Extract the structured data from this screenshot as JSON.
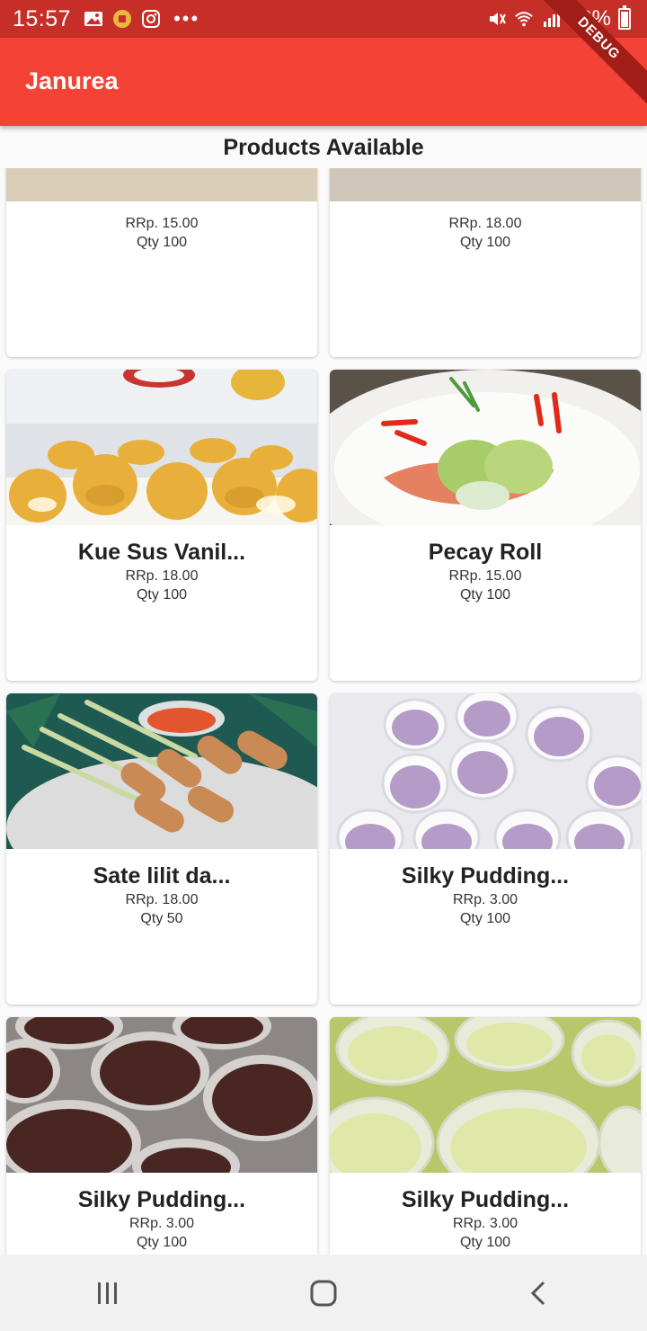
{
  "status_bar": {
    "time": "15:57",
    "battery_text": "99%",
    "icons": [
      "gallery-icon",
      "notification-icon",
      "instagram-icon",
      "more-dots-icon",
      "mute-icon",
      "wifi-icon",
      "signal-icon",
      "battery-icon"
    ]
  },
  "app_bar": {
    "title": "Janurea"
  },
  "debug_banner": "DEBUG",
  "section_title": "Products Available",
  "products": [
    {
      "name": "",
      "price": "RRp. 15.00",
      "qty": "Qty 100",
      "image": "food-photo"
    },
    {
      "name": "",
      "price": "RRp. 18.00",
      "qty": "Qty 100",
      "image": "food-photo"
    },
    {
      "name": "Kue Sus Vanil...",
      "price": "RRp. 18.00",
      "qty": "Qty 100",
      "image": "cream-puffs-photo"
    },
    {
      "name": "Pecay Roll",
      "price": "RRp. 15.00",
      "qty": "Qty 100",
      "image": "cabbage-roll-photo"
    },
    {
      "name": "Sate lilit da...",
      "price": "RRp. 18.00",
      "qty": "Qty 50",
      "image": "satay-skewers-photo"
    },
    {
      "name": "Silky Pudding...",
      "price": "RRp. 3.00",
      "qty": "Qty 100",
      "image": "taro-pudding-cups-photo"
    },
    {
      "name": "Silky Pudding...",
      "price": "RRp. 3.00",
      "qty": "Qty 100",
      "image": "chocolate-pudding-cups-photo"
    },
    {
      "name": "Silky Pudding...",
      "price": "RRp. 3.00",
      "qty": "Qty 100",
      "image": "pandan-pudding-cups-photo"
    }
  ],
  "nav_bar": {
    "buttons": [
      "recent-apps-icon",
      "home-icon",
      "back-icon"
    ]
  },
  "colors": {
    "status_bar": "#c62f27",
    "app_bar": "#f44336",
    "debug_banner": "#a11d18"
  }
}
